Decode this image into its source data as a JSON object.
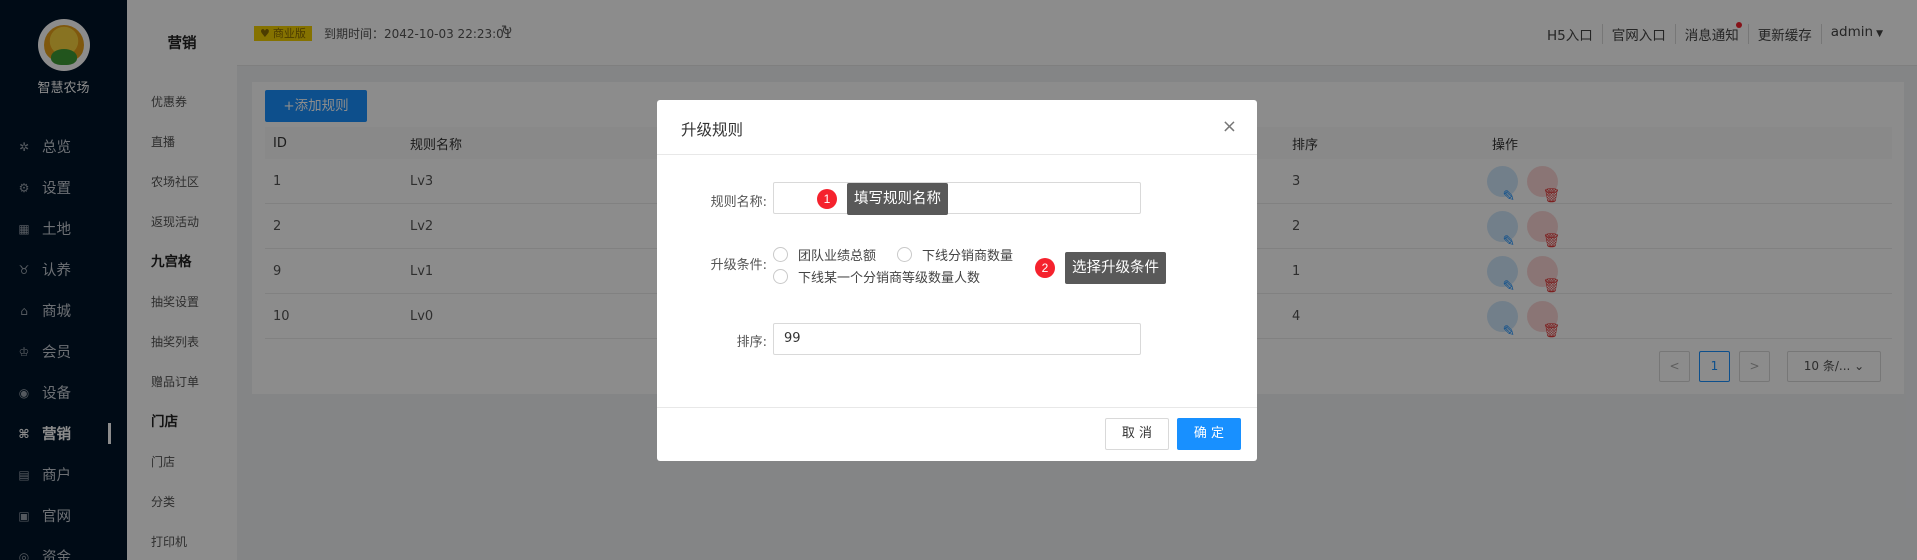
{
  "brand": {
    "name": "智慧农场"
  },
  "nav": {
    "items": [
      {
        "label": "总览",
        "icon": "dashboard-icon"
      },
      {
        "label": "设置",
        "icon": "gear-icon"
      },
      {
        "label": "土地",
        "icon": "grid-icon"
      },
      {
        "label": "认养",
        "icon": "cow-icon"
      },
      {
        "label": "商城",
        "icon": "shop-icon"
      },
      {
        "label": "会员",
        "icon": "member-icon"
      },
      {
        "label": "设备",
        "icon": "location-icon"
      },
      {
        "label": "营销",
        "icon": "command-icon",
        "active": true
      },
      {
        "label": "商户",
        "icon": "merchant-icon"
      },
      {
        "label": "官网",
        "icon": "website-icon"
      },
      {
        "label": "资金",
        "icon": "money-icon"
      }
    ]
  },
  "subnav": {
    "title": "营销",
    "items": [
      {
        "label": "优惠券"
      },
      {
        "label": "直播"
      },
      {
        "label": "农场社区"
      },
      {
        "label": "返现活动"
      },
      {
        "label": "九宫格",
        "group": true
      },
      {
        "label": "抽奖设置"
      },
      {
        "label": "抽奖列表"
      },
      {
        "label": "赠品订单"
      },
      {
        "label": "门店",
        "group": true
      },
      {
        "label": "门店"
      },
      {
        "label": "分类"
      },
      {
        "label": "打印机"
      }
    ]
  },
  "header": {
    "badge": "商业版",
    "expire": "到期时间：2042-10-03 22:23:01",
    "links": [
      "H5入口",
      "官网入口",
      "消息通知",
      "更新缓存"
    ],
    "user": "admin"
  },
  "toolbar": {
    "add_label": "+添加规则"
  },
  "table": {
    "columns": {
      "id": "ID",
      "name": "规则名称",
      "sort": "排序",
      "op": "操作"
    },
    "rows": [
      {
        "id": "1",
        "name": "Lv3",
        "sort": "3"
      },
      {
        "id": "2",
        "name": "Lv2",
        "sort": "2"
      },
      {
        "id": "9",
        "name": "Lv1",
        "sort": "1"
      },
      {
        "id": "10",
        "name": "Lv0",
        "sort": "4"
      }
    ]
  },
  "pagination": {
    "prev": "<",
    "current": "1",
    "next": ">",
    "page_size": "10 条/..."
  },
  "modal": {
    "title": "升级规则",
    "close": "×",
    "name_label": "规则名称:",
    "name_value": "",
    "cond_label": "升级条件:",
    "options": [
      "团队业绩总额",
      "下线分销商数量",
      "下线某一个分销商等级数量人数"
    ],
    "sort_label": "排序:",
    "sort_value": "99",
    "cancel": "取 消",
    "ok": "确 定"
  },
  "callouts": [
    {
      "num": "1",
      "text": "填写规则名称"
    },
    {
      "num": "2",
      "text": "选择升级条件"
    }
  ],
  "colors": {
    "primary": "#1890ff",
    "nav_bg": "#001529",
    "danger": "#f5222d"
  }
}
